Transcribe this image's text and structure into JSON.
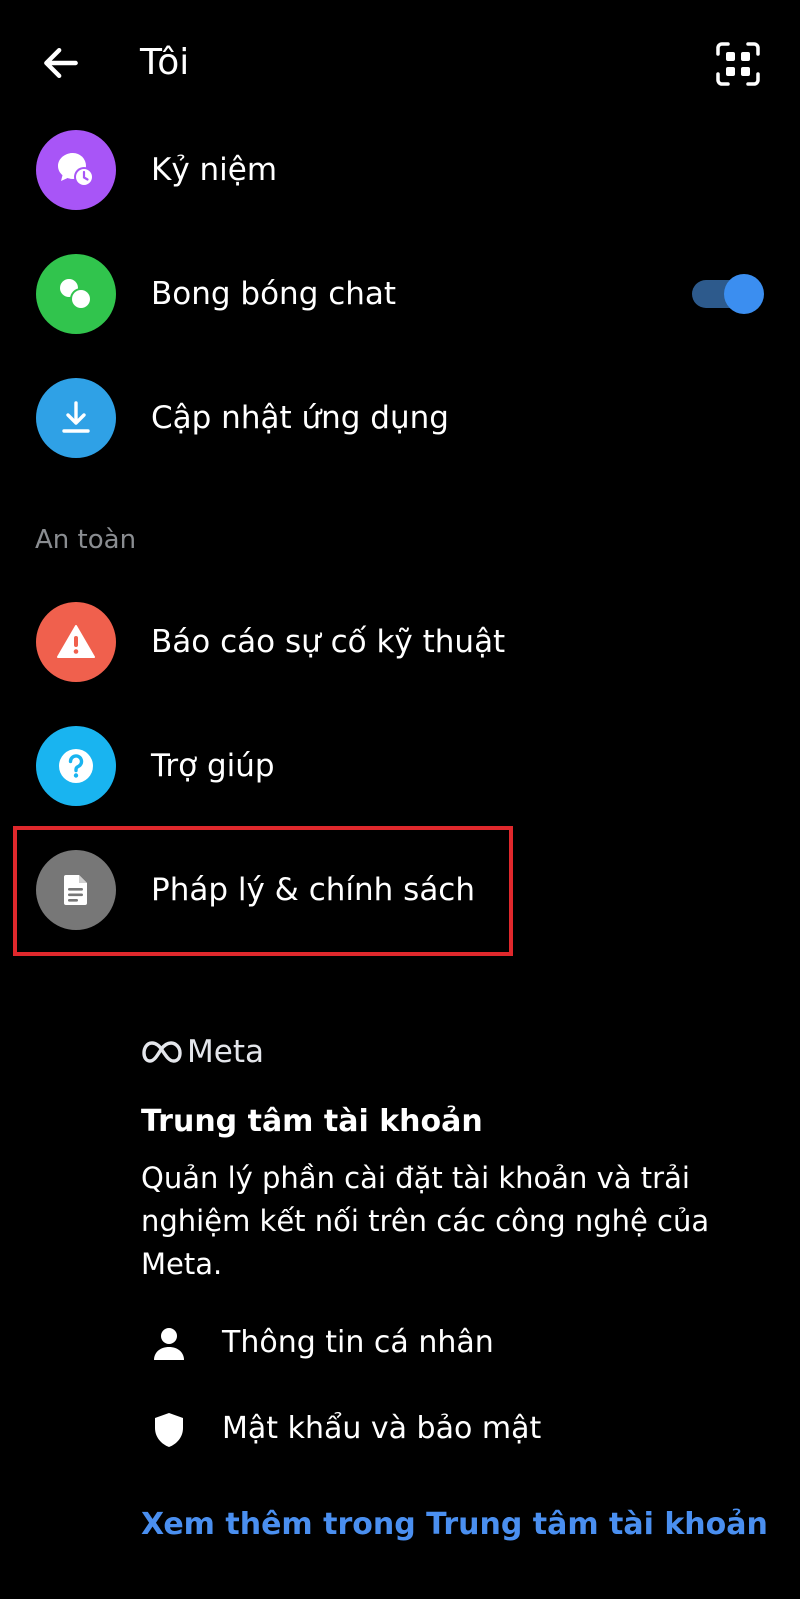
{
  "header": {
    "title": "Tôi",
    "back_icon": "arrow-left-icon",
    "qr_icon": "qr-code-icon"
  },
  "rows_top": [
    {
      "label": "Kỷ niệm",
      "icon": "memories-clock-icon",
      "color": "#a855f7"
    },
    {
      "label": "Bong bóng chat",
      "icon": "chat-bubbles-icon",
      "color": "#31c44d",
      "toggle_on": true
    },
    {
      "label": "Cập nhật ứng dụng",
      "icon": "download-icon",
      "color": "#2fa1e6"
    }
  ],
  "section": {
    "label": "An toàn"
  },
  "rows_safety": [
    {
      "label": "Báo cáo sự cố kỹ thuật",
      "icon": "warning-icon",
      "color": "#f0604d"
    },
    {
      "label": "Trợ giúp",
      "icon": "help-icon",
      "color": "#19b4f0"
    },
    {
      "label": "Pháp lý & chính sách",
      "icon": "document-icon",
      "color": "#777777"
    }
  ],
  "accounts_center": {
    "brand": "Meta",
    "title": "Trung tâm tài khoản",
    "description": "Quản lý phần cài đặt tài khoản và trải nghiệm kết nối trên các công nghệ của Meta.",
    "items": [
      {
        "label": "Thông tin cá nhân",
        "icon": "person-icon"
      },
      {
        "label": "Mật khẩu và bảo mật",
        "icon": "shield-icon"
      }
    ],
    "see_more": "Xem thêm trong Trung tâm tài khoản"
  },
  "colors": {
    "background": "#000000",
    "text": "#ffffff",
    "muted": "#8a8d91",
    "link": "#4a8ff0",
    "toggle_track": "#2d5a8c",
    "toggle_knob": "#3b8ef0",
    "highlight": "#e0282c"
  }
}
